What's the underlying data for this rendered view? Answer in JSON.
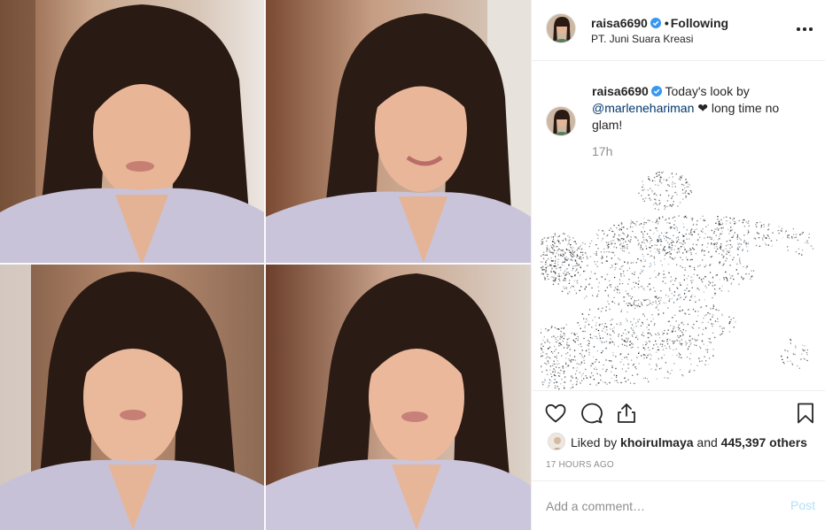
{
  "post": {
    "media_description": "photo-collage",
    "author": {
      "username": "raisa6690",
      "location": "PT. Juni Suara Kreasi",
      "follow_status": "Following",
      "separator": "•"
    },
    "caption": {
      "username": "raisa6690",
      "text_before": "Today's look by",
      "mention": "@marlenehariman",
      "heart": "❤",
      "text_after": "long time no glam!",
      "time_ago": "17h"
    },
    "likes": {
      "prefix": "Liked by",
      "first_liker": "khoirulmaya",
      "connector": "and",
      "others": "445,397 others"
    },
    "date": "17 HOURS AGO",
    "comment": {
      "placeholder": "Add a comment…",
      "post_label": "Post"
    }
  },
  "icons": {
    "like": "heart-icon",
    "comment": "comment-icon",
    "share": "share-icon",
    "save": "bookmark-icon",
    "more": "more-options-icon",
    "verified": "verified-badge-icon"
  },
  "colors": {
    "text": "#262626",
    "muted": "#8e8e8e",
    "link": "#00376b",
    "verified": "#3897f0",
    "post_disabled": "#b2dffc",
    "divider": "#efefef"
  }
}
